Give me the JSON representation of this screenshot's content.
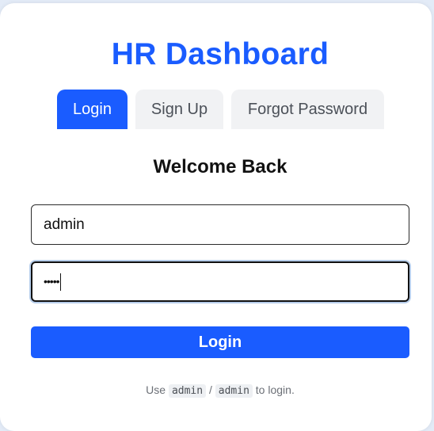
{
  "app": {
    "title": "HR Dashboard",
    "accent_color": "#1a5cff",
    "tab_inactive_bg": "#f1f2f4"
  },
  "tabs": [
    {
      "label": "Login",
      "active": true
    },
    {
      "label": "Sign Up",
      "active": false
    },
    {
      "label": "Forgot Password",
      "active": false
    }
  ],
  "form": {
    "heading": "Welcome Back",
    "username": {
      "value": "admin",
      "placeholder": ""
    },
    "password": {
      "masked_value": "•••••",
      "focused": true
    },
    "submit_label": "Login"
  },
  "hint": {
    "prefix": "Use",
    "username": "admin",
    "separator": "/",
    "password": "admin",
    "suffix": "to login."
  }
}
